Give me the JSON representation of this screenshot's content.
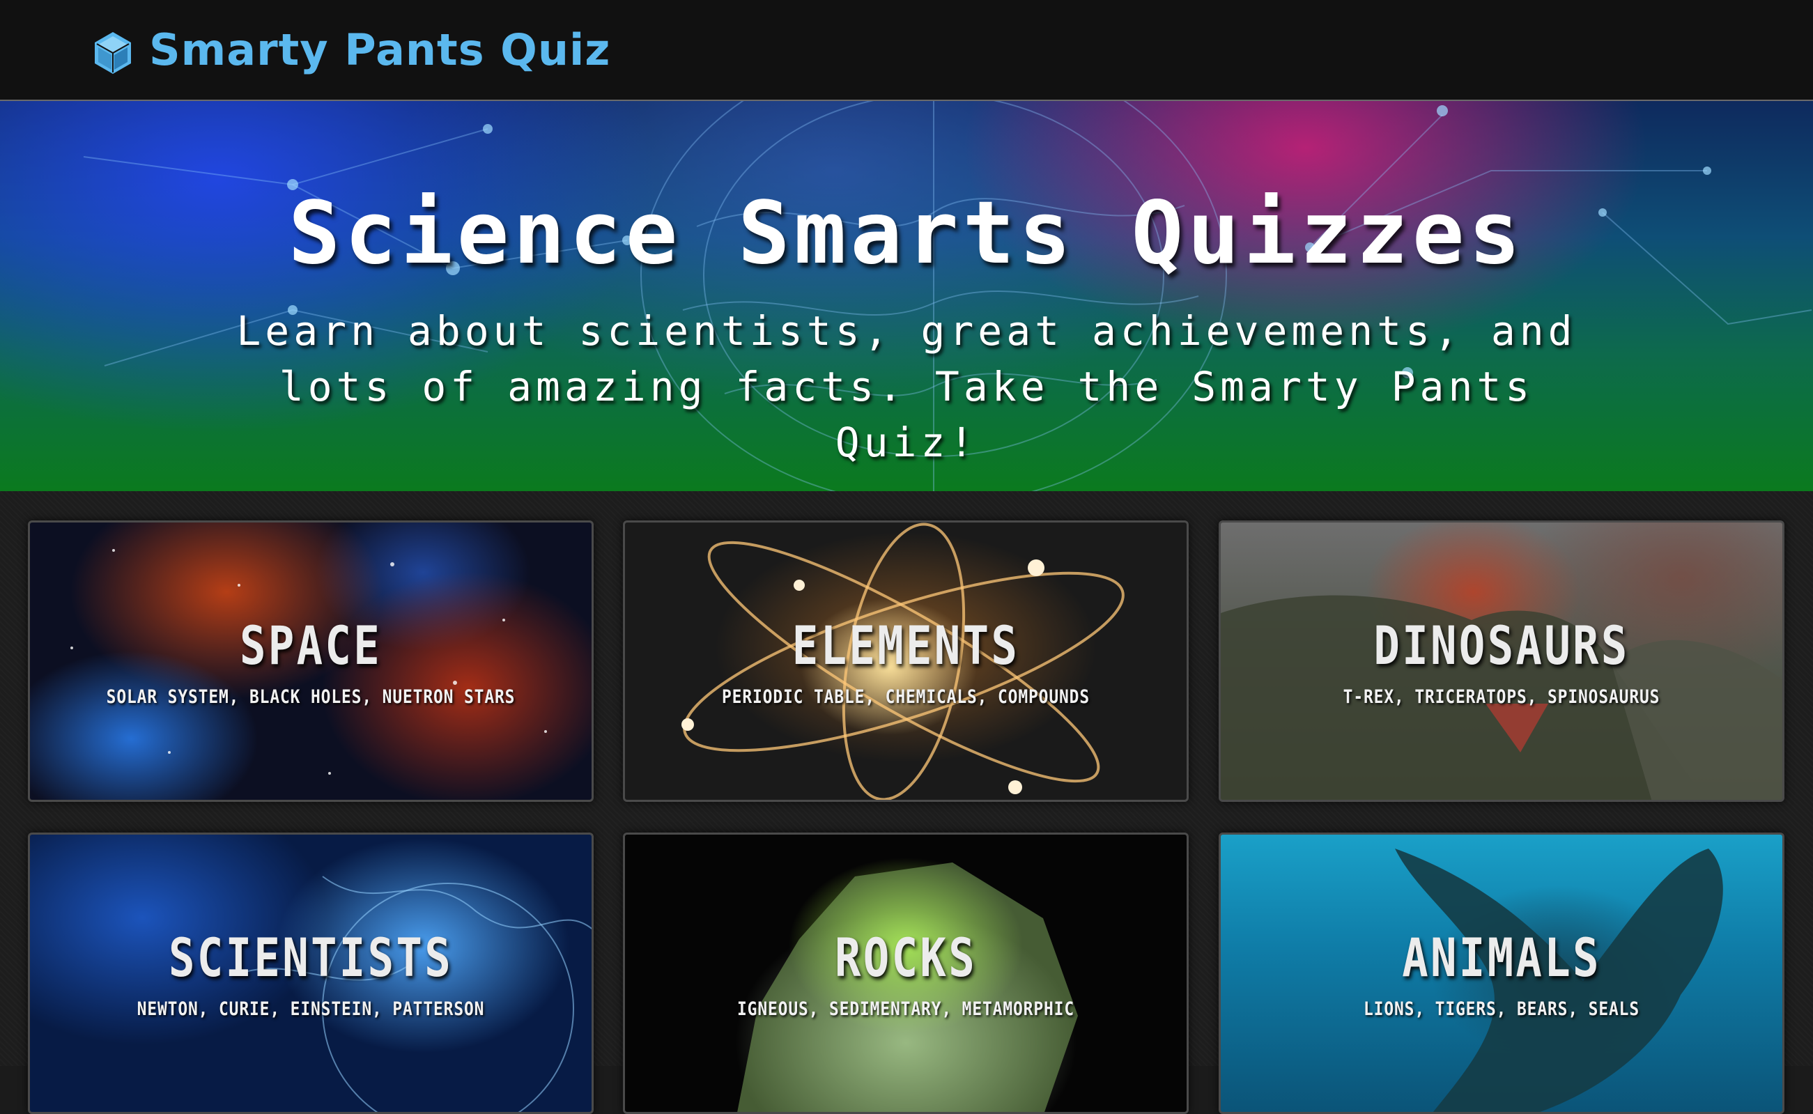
{
  "header": {
    "app_name": "Smarty Pants Quiz",
    "logo_icon": "cube-icon",
    "brand_color": "#5bb8ee"
  },
  "hero": {
    "title": "Science Smarts Quizzes",
    "subtitle": "Learn about scientists, great achievements, and lots of amazing facts. Take the Smarty Pants Quiz!"
  },
  "categories": [
    {
      "title": "SPACE",
      "subtitle": "SOLAR SYSTEM, BLACK HOLES, NUETRON STARS"
    },
    {
      "title": "ELEMENTS",
      "subtitle": "PERIODIC TABLE, CHEMICALS, COMPOUNDS"
    },
    {
      "title": "DINOSAURS",
      "subtitle": "T-REX, TRICERATOPS, SPINOSAURUS"
    },
    {
      "title": "SCIENTISTS",
      "subtitle": "NEWTON, CURIE, EINSTEIN, PATTERSON"
    },
    {
      "title": "ROCKS",
      "subtitle": "IGNEOUS, SEDIMENTARY, METAMORPHIC"
    },
    {
      "title": "ANIMALS",
      "subtitle": "LIONS, TIGERS, BEARS, SEALS"
    }
  ]
}
